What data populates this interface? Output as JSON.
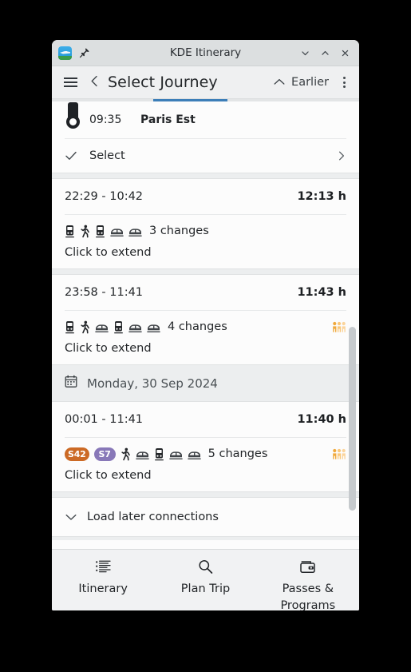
{
  "window": {
    "title": "KDE Itinerary",
    "app_icon": "kde-itinerary-icon",
    "pin_icon": "pin-icon",
    "minimize_icon": "chevron-down-icon",
    "maximize_icon": "chevron-up-icon",
    "close_icon": "close-icon"
  },
  "toolbar": {
    "menu_icon": "hamburger-menu-icon",
    "back_icon": "chevron-left-icon",
    "page_title": "Select Journey",
    "earlier_label": "Earlier",
    "earlier_icon": "chevron-up-icon",
    "overflow_icon": "overflow-menu-icon"
  },
  "colors": {
    "accent": "#3c7eb8",
    "badge_s42": "#cc6a25",
    "badge_s7": "#8878b8",
    "occupancy": "#f7bd5c",
    "titlebar": "#dcdfe0",
    "toolbar": "#eff0f1",
    "band": "#eceeef"
  },
  "top_partial_journey": {
    "stop_time": "09:35",
    "stop_name": "Paris Est",
    "select_label": "Select",
    "select_check_icon": "check-icon",
    "select_arrow_icon": "chevron-right-icon"
  },
  "journeys": [
    {
      "times": "22:29 - 10:42",
      "duration": "12:13 h",
      "modes": [
        {
          "type": "icon",
          "icon": "tram-icon"
        },
        {
          "type": "icon",
          "icon": "walk-icon"
        },
        {
          "type": "icon",
          "icon": "tram-icon"
        },
        {
          "type": "icon",
          "icon": "train-icon"
        },
        {
          "type": "icon",
          "icon": "train-icon"
        }
      ],
      "changes": "3 changes",
      "occupancy_icon": null,
      "extend_label": "Click to extend"
    },
    {
      "times": "23:58 - 11:41",
      "duration": "11:43 h",
      "modes": [
        {
          "type": "icon",
          "icon": "tram-icon"
        },
        {
          "type": "icon",
          "icon": "walk-icon"
        },
        {
          "type": "icon",
          "icon": "train-icon"
        },
        {
          "type": "icon",
          "icon": "tram-icon"
        },
        {
          "type": "icon",
          "icon": "train-icon"
        },
        {
          "type": "icon",
          "icon": "train-icon"
        }
      ],
      "changes": "4 changes",
      "occupancy_icon": "occupancy-icon",
      "extend_label": "Click to extend"
    }
  ],
  "date_header": {
    "icon": "calendar-icon",
    "label": "Monday, 30 Sep 2024"
  },
  "journeys_after_date": [
    {
      "times": "00:01 - 11:41",
      "duration": "11:40 h",
      "modes": [
        {
          "type": "badge",
          "label": "S42",
          "color": "#cc6a25"
        },
        {
          "type": "badge",
          "label": "S7",
          "color": "#8878b8"
        },
        {
          "type": "icon",
          "icon": "walk-icon"
        },
        {
          "type": "icon",
          "icon": "train-icon"
        },
        {
          "type": "icon",
          "icon": "tram-icon"
        },
        {
          "type": "icon",
          "icon": "train-icon"
        },
        {
          "type": "icon",
          "icon": "train-icon"
        }
      ],
      "changes": "5 changes",
      "occupancy_icon": "occupancy-icon",
      "extend_label": "Click to extend"
    }
  ],
  "load_later": {
    "icon": "chevron-down-icon",
    "label": "Load later connections"
  },
  "bottom_nav": [
    {
      "label": "Itinerary",
      "icon": "list-icon"
    },
    {
      "label": "Plan Trip",
      "icon": "search-icon"
    },
    {
      "label": "Passes & Programs",
      "icon": "wallet-icon"
    }
  ]
}
